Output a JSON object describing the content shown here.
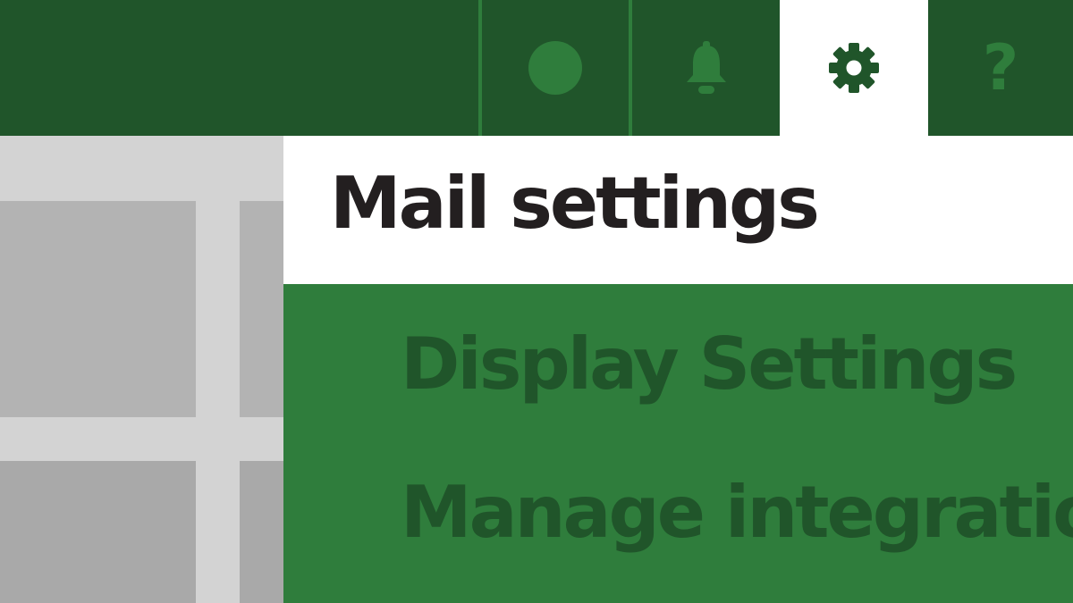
{
  "topbar": {
    "buttons": [
      {
        "name": "status",
        "icon": "status-dot-icon"
      },
      {
        "name": "notifications",
        "icon": "bell-icon"
      },
      {
        "name": "settings",
        "icon": "gear-icon",
        "selected": true
      },
      {
        "name": "help",
        "icon": "question-icon",
        "glyph": "?"
      }
    ]
  },
  "settings": {
    "title": "Mail settings",
    "items": [
      {
        "label": "Display Settings"
      },
      {
        "label": "Manage integrations"
      }
    ]
  },
  "colors": {
    "topbar_bg": "#20552a",
    "accent_green": "#2f7d3c",
    "menu_text": "#20552a",
    "title_text": "#231f20",
    "panel_gray": "#d3d3d3",
    "tile_gray": "#b3b3b3"
  }
}
